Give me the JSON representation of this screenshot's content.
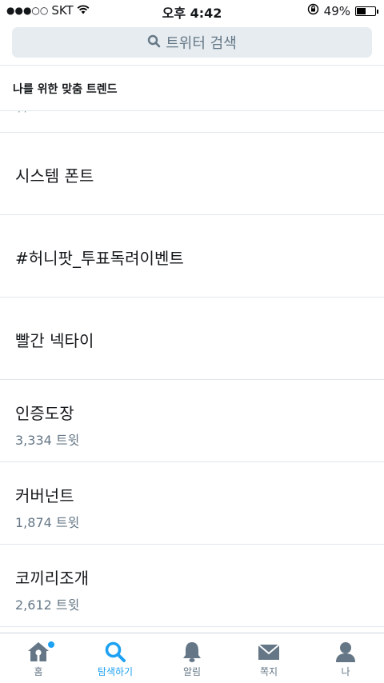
{
  "status_bar": {
    "signal": "●●●○○",
    "carrier": "SKT",
    "time": "오후 4:42",
    "battery_percent": "49%",
    "battery_level": 0.49
  },
  "search": {
    "placeholder": "트위터 검색"
  },
  "section": {
    "title": "나를 위한 맞춤 트렌드"
  },
  "partial_item": {
    "text": "· ·"
  },
  "trends": [
    {
      "name": "시스템 폰트",
      "count": ""
    },
    {
      "name": "#허니팟_투표독려이벤트",
      "count": ""
    },
    {
      "name": "빨간 넥타이",
      "count": ""
    },
    {
      "name": "인증도장",
      "count": "3,334 트윗"
    },
    {
      "name": "커버넌트",
      "count": "1,874 트윗"
    },
    {
      "name": "코끼리조개",
      "count": "2,612 트윗"
    }
  ],
  "tabs": [
    {
      "label": "홈",
      "icon": "home-icon",
      "active": false,
      "notification": true
    },
    {
      "label": "탐색하기",
      "icon": "search-icon",
      "active": true,
      "notification": false
    },
    {
      "label": "알림",
      "icon": "bell-icon",
      "active": false,
      "notification": false
    },
    {
      "label": "쪽지",
      "icon": "envelope-icon",
      "active": false,
      "notification": false
    },
    {
      "label": "나",
      "icon": "person-icon",
      "active": false,
      "notification": false
    }
  ],
  "colors": {
    "accent": "#1da1f2",
    "icon_inactive": "#657786",
    "search_bg": "#e6ecf0"
  }
}
